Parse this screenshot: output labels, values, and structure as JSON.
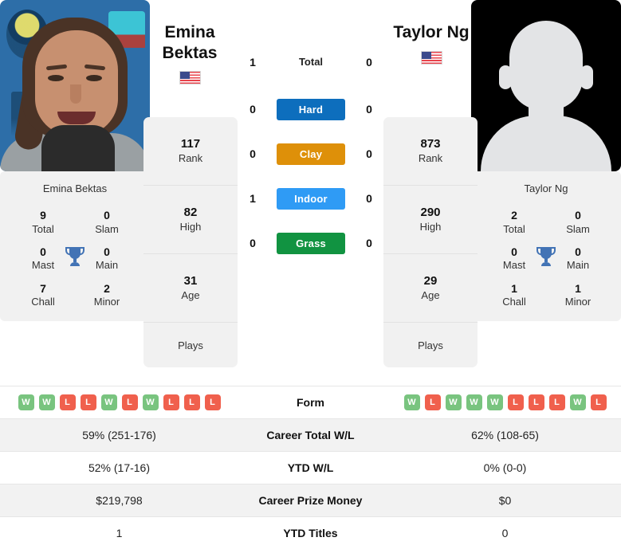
{
  "players": {
    "left": {
      "name_line1": "Emina",
      "name_line2": "Bektas",
      "full_name": "Emina Bektas",
      "country": "USA",
      "photo_caption": "Emina Bektas",
      "rank": "117",
      "rank_label": "Rank",
      "high": "82",
      "high_label": "High",
      "age": "31",
      "age_label": "Age",
      "plays_label": "Plays",
      "plays_value": "",
      "titles": {
        "total": "9",
        "total_label": "Total",
        "slam": "0",
        "slam_label": "Slam",
        "mast": "0",
        "mast_label": "Mast",
        "main": "0",
        "main_label": "Main",
        "chall": "7",
        "chall_label": "Chall",
        "minor": "2",
        "minor_label": "Minor"
      },
      "form": [
        "W",
        "W",
        "L",
        "L",
        "W",
        "L",
        "W",
        "L",
        "L",
        "L"
      ],
      "career_total_wl": "59% (251-176)",
      "ytd_wl": "52% (17-16)",
      "career_prize_money": "$219,798",
      "ytd_titles": "1"
    },
    "right": {
      "name_line1": "Taylor Ng",
      "name_line2": "",
      "full_name": "Taylor Ng",
      "country": "USA",
      "photo_caption": "Taylor Ng",
      "rank": "873",
      "rank_label": "Rank",
      "high": "290",
      "high_label": "High",
      "age": "29",
      "age_label": "Age",
      "plays_label": "Plays",
      "plays_value": "",
      "titles": {
        "total": "2",
        "total_label": "Total",
        "slam": "0",
        "slam_label": "Slam",
        "mast": "0",
        "mast_label": "Mast",
        "main": "0",
        "main_label": "Main",
        "chall": "1",
        "chall_label": "Chall",
        "minor": "1",
        "minor_label": "Minor"
      },
      "form": [
        "W",
        "L",
        "W",
        "W",
        "W",
        "L",
        "L",
        "L",
        "W",
        "L"
      ],
      "career_total_wl": "62% (108-65)",
      "ytd_wl": "0% (0-0)",
      "career_prize_money": "$0",
      "ytd_titles": "0"
    }
  },
  "head_to_head": {
    "total": {
      "label": "Total",
      "left": "1",
      "right": "0"
    },
    "surfaces": [
      {
        "label": "Hard",
        "left": "0",
        "right": "0",
        "color": "#0d6ebd"
      },
      {
        "label": "Clay",
        "left": "0",
        "right": "0",
        "color": "#de9009"
      },
      {
        "label": "Indoor",
        "left": "1",
        "right": "0",
        "color": "#2f9bf5"
      },
      {
        "label": "Grass",
        "left": "0",
        "right": "0",
        "color": "#119341"
      }
    ]
  },
  "stats_table": {
    "rows": [
      {
        "label": "Form",
        "left": "",
        "right": ""
      },
      {
        "label": "Career Total W/L",
        "left": "59% (251-176)",
        "right": "62% (108-65)"
      },
      {
        "label": "YTD W/L",
        "left": "52% (17-16)",
        "right": "0% (0-0)"
      },
      {
        "label": "Career Prize Money",
        "left": "$219,798",
        "right": "$0"
      },
      {
        "label": "YTD Titles",
        "left": "1",
        "right": "0"
      }
    ]
  },
  "colors": {
    "win_badge": "#79c47f",
    "loss_badge": "#f0604d",
    "trophy": "#4273b5",
    "card_bg": "#f1f1f1"
  }
}
